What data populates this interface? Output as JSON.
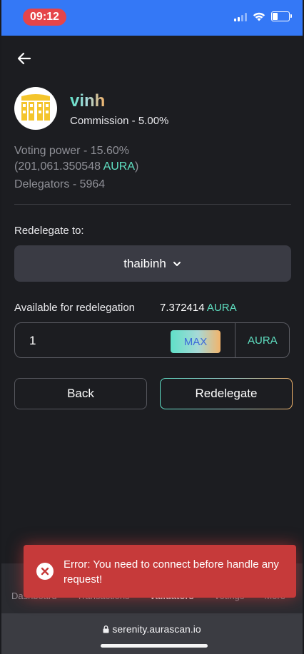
{
  "status_bar": {
    "time": "09:12"
  },
  "validator": {
    "name": "vinh",
    "commission": "Commission - 5.00%",
    "voting_power_line1": "Voting power - 15.60%",
    "voting_power_amount": "(201,061.350548 ",
    "voting_power_unit": "AURA",
    "voting_power_close": ")",
    "delegators": "Delegators - 5964"
  },
  "form": {
    "redelegate_to_label": "Redelegate to:",
    "selected_validator": "thaibinh",
    "available_label": "Available for redelegation",
    "available_value": "7.372414",
    "available_unit": "AURA",
    "amount_value": "1",
    "max_label": "MAX",
    "amount_unit": "AURA",
    "back_label": "Back",
    "redelegate_label": "Redelegate"
  },
  "bottom_nav": {
    "items": [
      "Dashboard",
      "Transactions",
      "Validators",
      "Votings",
      "More"
    ],
    "active": "Validators"
  },
  "browser": {
    "url": "serenity.aurascan.io"
  },
  "toast": {
    "message": "Error: You need to connect before handle any request!"
  },
  "colors": {
    "accent": "#5fe0c2",
    "status_bar": "#3478f6",
    "error": "#c63a3a"
  },
  "icons": [
    "back-arrow-icon",
    "chevron-down-icon",
    "close-circle-icon",
    "lock-icon",
    "wifi-icon",
    "battery-icon",
    "signal-icon"
  ]
}
